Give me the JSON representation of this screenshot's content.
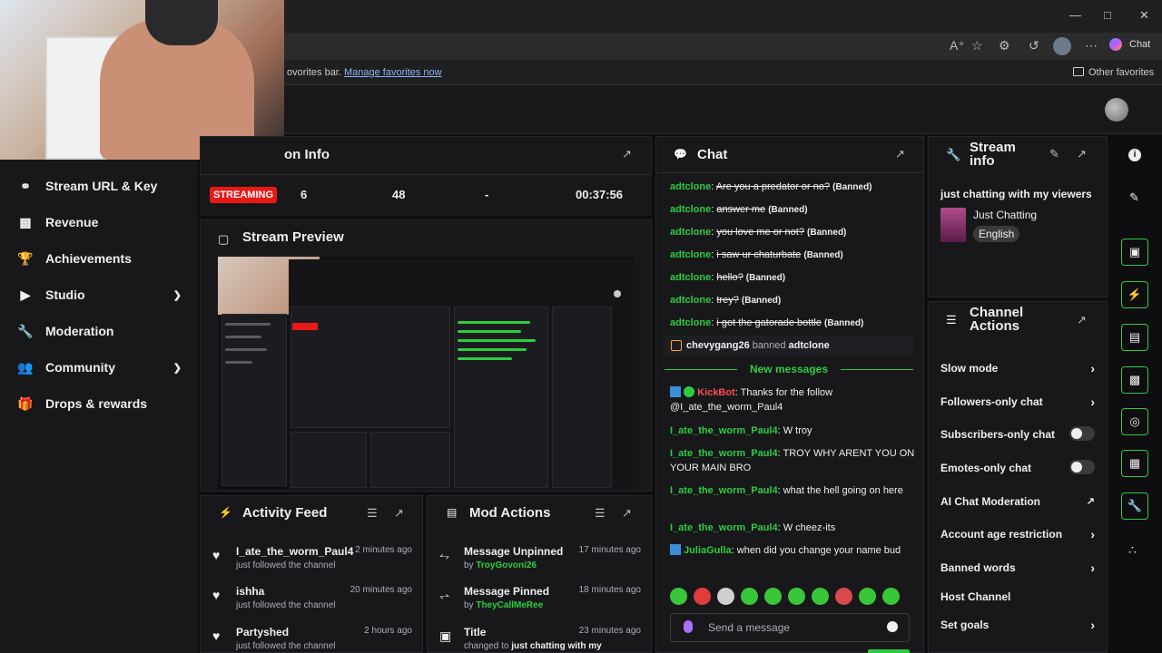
{
  "browser": {
    "chat_label": "Chat",
    "fav_text": "ovorites bar.",
    "fav_link": "Manage favorites now",
    "other_favorites": "Other favorites"
  },
  "sidebar": {
    "items": [
      {
        "label": "Stream URL & Key",
        "icon": "link-icon"
      },
      {
        "label": "Revenue",
        "icon": "chart-icon"
      },
      {
        "label": "Achievements",
        "icon": "trophy-icon"
      },
      {
        "label": "Studio",
        "icon": "video-icon",
        "expand": true
      },
      {
        "label": "Moderation",
        "icon": "wrench-icon"
      },
      {
        "label": "Community",
        "icon": "people-icon",
        "expand": true
      },
      {
        "label": "Drops & rewards",
        "icon": "gift-icon"
      }
    ]
  },
  "session": {
    "title": "on Info",
    "badge": "STREAMING",
    "viewers": "6",
    "followers": "48",
    "subs": "-",
    "uptime": "00:37:56"
  },
  "preview": {
    "title": "Stream Preview"
  },
  "chat": {
    "title": "Chat",
    "messages": [
      {
        "user": "adtclone",
        "text": "Are you a predator or no?",
        "banned": "(Banned)"
      },
      {
        "user": "adtclone",
        "text": "answer me",
        "banned": "(Banned)"
      },
      {
        "user": "adtclone",
        "text": "you love me or not?",
        "banned": "(Banned)"
      },
      {
        "user": "adtclone",
        "text": "i saw ur chaturbate",
        "banned": "(Banned)"
      },
      {
        "user": "adtclone",
        "text": "hello?",
        "banned": "(Banned)"
      },
      {
        "user": "adtclone",
        "text": "trey?",
        "banned": "(Banned)"
      },
      {
        "user": "adtclone",
        "text": "i got the gatorade bottle",
        "banned": "(Banned)"
      }
    ],
    "ban_notice": {
      "actor": "chevygang26",
      "action": "banned",
      "target": "adtclone"
    },
    "new_messages": "New messages",
    "recent": [
      {
        "user": "KickBot",
        "text": ": Thanks for the follow @I_ate_the_worm_Paul4"
      },
      {
        "user": "I_ate_the_worm_Paul4",
        "text": ": W troy"
      },
      {
        "user": "I_ate_the_worm_Paul4",
        "text": ": TROY WHY ARENT YOU ON YOUR MAIN BRO"
      },
      {
        "user": "I_ate_the_worm_Paul4",
        "text": ": what the hell going on here"
      },
      {
        "user": "I_ate_the_worm_Paul4",
        "text": ": W cheez-its"
      },
      {
        "user": "JuliaGulla",
        "text": ": when did you change your name bud"
      }
    ],
    "placeholder": "Send a message"
  },
  "stream_info": {
    "title": "Stream info",
    "stream_title": "just chatting with my viewers",
    "category": "Just Chatting",
    "language": "English"
  },
  "channel_actions": {
    "title": "Channel Actions",
    "rows": [
      {
        "label": "Slow mode",
        "type": "chevron"
      },
      {
        "label": "Followers-only chat",
        "type": "chevron"
      },
      {
        "label": "Subscribers-only chat",
        "type": "toggle"
      },
      {
        "label": "Emotes-only chat",
        "type": "toggle"
      },
      {
        "label": "AI Chat Moderation",
        "type": "external"
      },
      {
        "label": "Account age restriction",
        "type": "chevron"
      },
      {
        "label": "Banned words",
        "type": "chevron"
      },
      {
        "label": "Host Channel",
        "type": "none"
      },
      {
        "label": "Set goals",
        "type": "chevron"
      }
    ]
  },
  "activity": {
    "title": "Activity Feed",
    "rows": [
      {
        "name": "I_ate_the_worm_Paul4",
        "sub": "just followed the channel",
        "time": "2 minutes ago"
      },
      {
        "name": "ishha",
        "sub": "just followed the channel",
        "time": "20 minutes ago"
      },
      {
        "name": "Partyshed",
        "sub": "just followed the channel",
        "time": "2 hours ago"
      }
    ]
  },
  "mod": {
    "title": "Mod Actions",
    "rows": [
      {
        "name": "Message Unpinned",
        "by": "by",
        "who": "TroyGovoni26",
        "time": "17 minutes ago"
      },
      {
        "name": "Message Pinned",
        "by": "by",
        "who": "TheyCallMeRee",
        "time": "18 minutes ago"
      },
      {
        "name": "Title",
        "by": "changed to",
        "who": "just chatting with my",
        "time": "23 minutes ago"
      }
    ]
  },
  "colors": {
    "accent": "#2ecc40",
    "live": "#e91916",
    "banned_user": "#ff4d4d"
  }
}
